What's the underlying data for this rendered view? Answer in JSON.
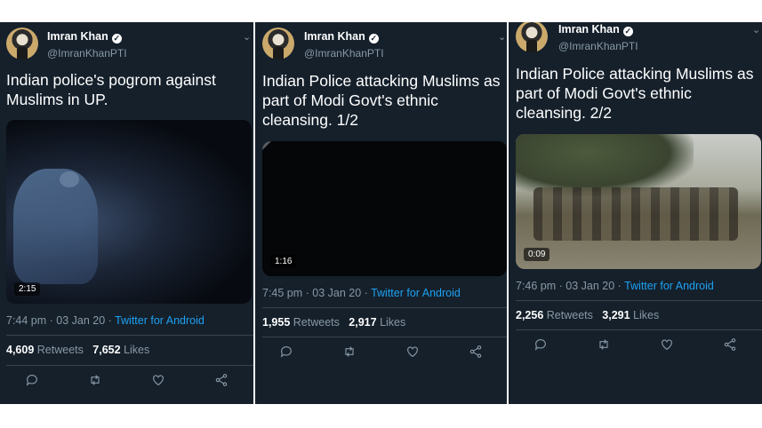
{
  "tweets": [
    {
      "author": "Imran Khan",
      "handle": "@ImranKhanPTI",
      "text": "Indian police's pogrom against Muslims in UP.",
      "duration": "2:15",
      "timestamp": "7:44 pm · 03 Jan 20 · ",
      "source": "Twitter for Android",
      "retweets": "4,609",
      "retweets_label": "Retweets",
      "likes": "7,652",
      "likes_label": "Likes"
    },
    {
      "author": "Imran Khan",
      "handle": "@ImranKhanPTI",
      "text": "Indian Police attacking Muslims as part of Modi Govt's ethnic cleansing. 1/2",
      "duration": "1:16",
      "timestamp": "7:45 pm · 03 Jan 20 · ",
      "source": "Twitter for Android",
      "retweets": "1,955",
      "retweets_label": "Retweets",
      "likes": "2,917",
      "likes_label": "Likes"
    },
    {
      "author": "Imran Khan",
      "handle": "@ImranKhanPTI",
      "text": "Indian Police attacking Muslims as part of Modi Govt's ethnic cleansing. 2/2",
      "duration": "0:09",
      "timestamp": "7:46 pm · 03 Jan 20 · ",
      "source": "Twitter for Android",
      "retweets": "2,256",
      "retweets_label": "Retweets",
      "likes": "3,291",
      "likes_label": "Likes"
    }
  ],
  "colors": {
    "background": "#15202b",
    "link": "#1da1f2",
    "muted": "#8899a6"
  },
  "icons": [
    "verified-badge-icon",
    "chevron-down-icon",
    "reply-icon",
    "retweet-icon",
    "like-icon",
    "share-icon"
  ]
}
